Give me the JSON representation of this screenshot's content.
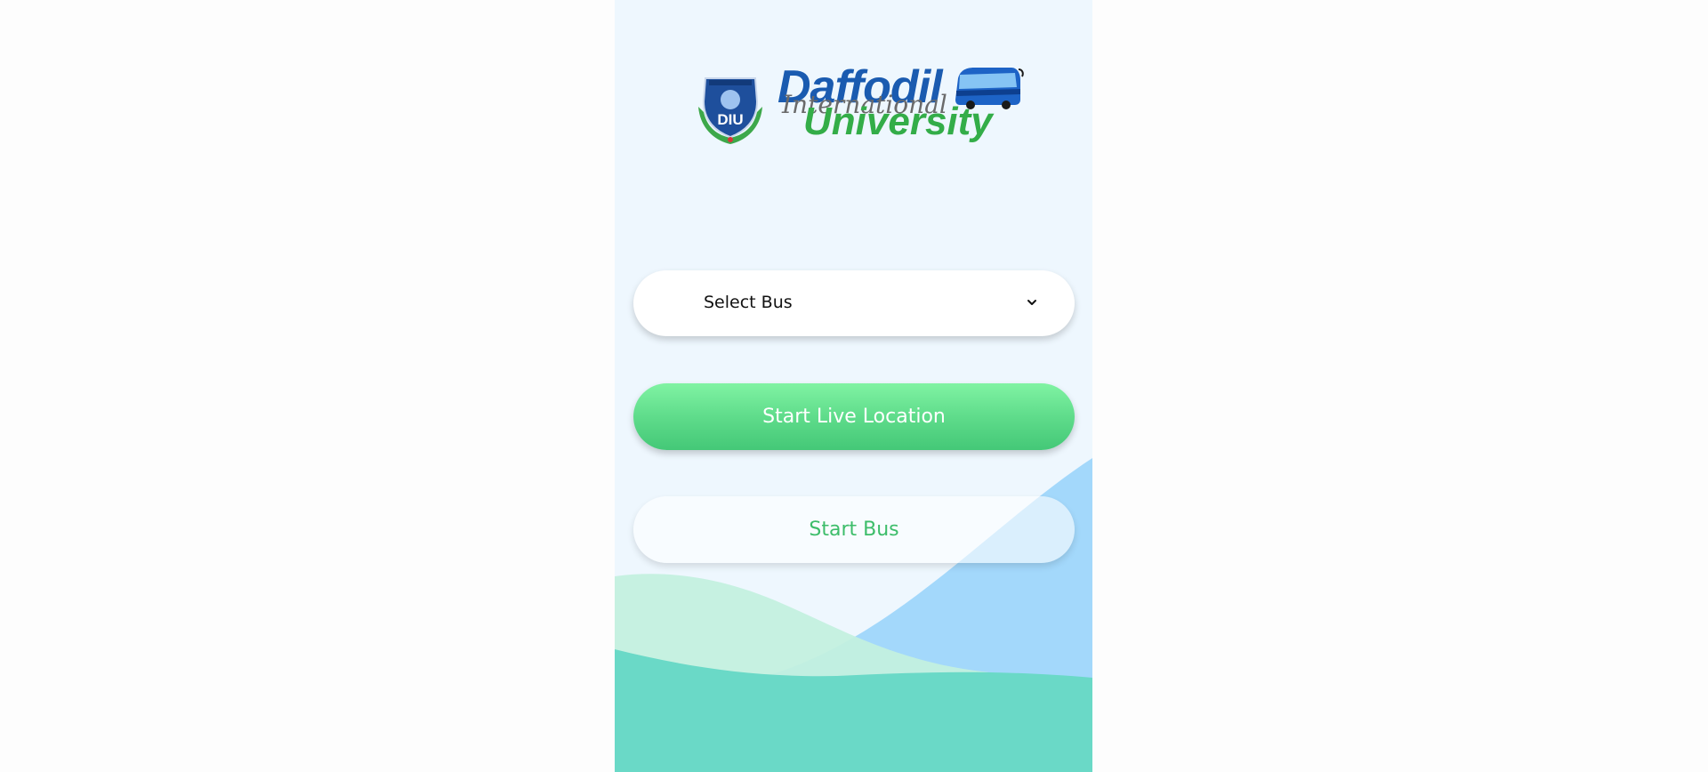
{
  "logo": {
    "line1": "Daffodil",
    "line2": "International",
    "line3": "University",
    "emblem_initials": "DIU",
    "emblem_icon": "university-emblem-icon",
    "bus_icon": "bus-icon"
  },
  "form": {
    "select_bus_label": "Select Bus",
    "chevron_icon": "chevron-down-icon"
  },
  "buttons": {
    "start_live_location": "Start Live Location",
    "start_bus": "Start Bus"
  },
  "colors": {
    "background": "#eef7fe",
    "primary_green": "#5fdc8b",
    "start_bus_text": "#3dbd6a",
    "wave_blue": "#a3d8fb",
    "wave_teal": "#6ad9c7",
    "wave_mint": "#c3f0df",
    "logo_blue": "#1a5bb0",
    "logo_green": "#33ad48"
  }
}
